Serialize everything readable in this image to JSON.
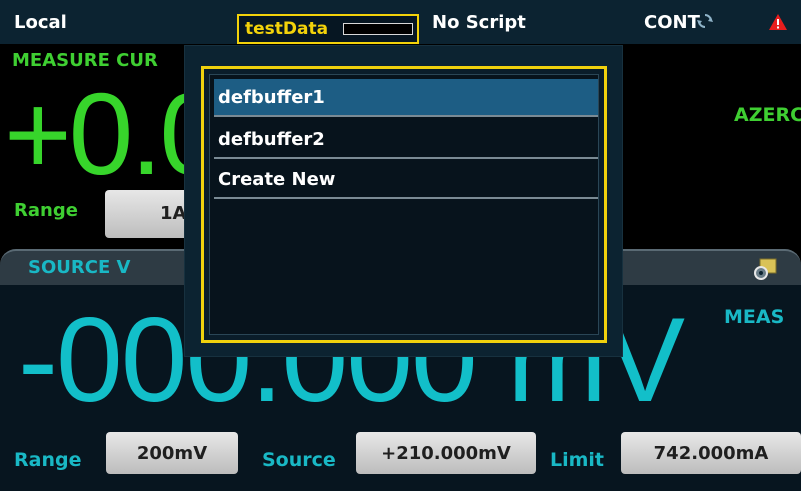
{
  "status_bar": {
    "location": "Local",
    "buffer_name": "testData",
    "script_status": "No Script",
    "trigger_mode": "CONT"
  },
  "measure": {
    "label": "MEASURE CUR",
    "value_visible": "+0.0",
    "azero": "AZERC",
    "range_label": "Range",
    "range_value_visible": "1A"
  },
  "source": {
    "header": "SOURCE V",
    "meas_label": "MEAS",
    "value_visible": "-000.000 mV"
  },
  "controls": {
    "range_label": "Range",
    "range_value": "200mV",
    "source_label": "Source",
    "source_value": "+210.000mV",
    "limit_label": "Limit",
    "limit_value": "742.000mA"
  },
  "buffer_popup": {
    "items": [
      {
        "label": "defbuffer1",
        "selected": true
      },
      {
        "label": "defbuffer2",
        "selected": false
      },
      {
        "label": "Create New",
        "selected": false
      }
    ]
  },
  "colors": {
    "measure_green": "#37d52b",
    "source_cyan": "#12bfc9",
    "highlight_yellow": "#f0d10d",
    "selected_blue": "#1d5d84"
  }
}
